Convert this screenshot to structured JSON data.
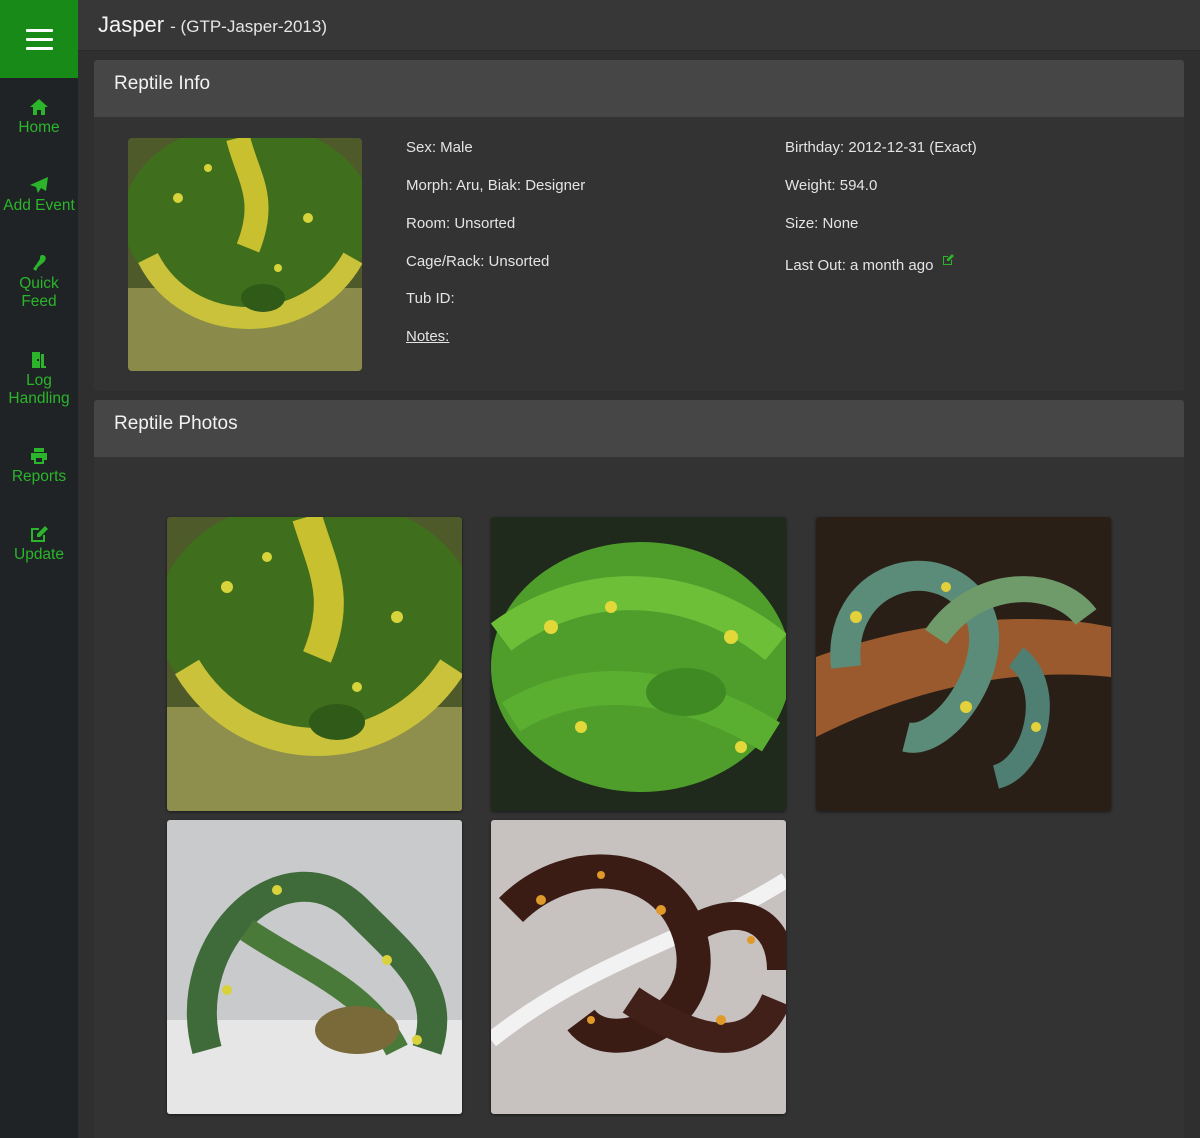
{
  "header": {
    "name": "Jasper",
    "id_text": "- (GTP-Jasper-2013)"
  },
  "sidebar": {
    "items": [
      {
        "label": "Home",
        "icon": "home-icon"
      },
      {
        "label": "Add Event",
        "icon": "paper-plane-icon"
      },
      {
        "label": "Quick Feed",
        "icon": "food-icon"
      },
      {
        "label": "Log Handling",
        "icon": "door-icon"
      },
      {
        "label": "Reports",
        "icon": "print-icon"
      },
      {
        "label": "Update",
        "icon": "edit-icon"
      }
    ]
  },
  "info": {
    "title": "Reptile Info",
    "sex": "Sex: Male",
    "morph": "Morph: Aru, Biak: Designer",
    "room": "Room: Unsorted",
    "cage": "Cage/Rack: Unsorted",
    "tub": "Tub ID:",
    "notes": "Notes:",
    "birthday": "Birthday: 2012-12-31 (Exact)",
    "weight": "Weight: 594.0",
    "size": "Size: None",
    "last_out": "Last Out: a month ago"
  },
  "photos": {
    "title": "Reptile Photos"
  },
  "colors": {
    "accent": "#178a17",
    "nav_text": "#2bb52b",
    "sidebar_bg": "#202325",
    "panel_header": "#464646"
  }
}
